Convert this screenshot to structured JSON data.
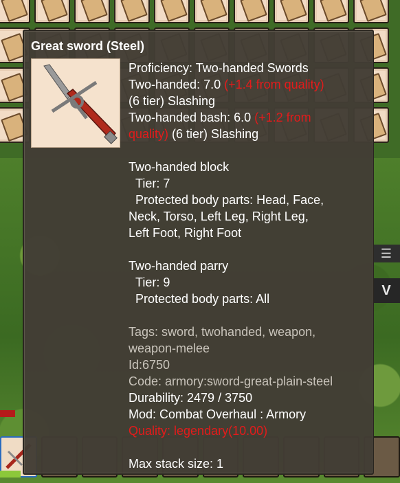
{
  "tooltip": {
    "title": "Great sword (Steel)",
    "icon": "great-sword-steel-icon",
    "proficiency": "Proficiency: Two-handed Swords",
    "two_handed": {
      "label": "Two-handed: 7.0 ",
      "quality_bonus": "(+1.4 from quality)",
      "tier": "(6 tier) Slashing"
    },
    "two_handed_bash": {
      "label": "Two-handed bash: 6.0 ",
      "quality_bonus_a": "(+1.2 from",
      "quality_bonus_b": "quality)",
      "tier": " (6 tier) Slashing"
    },
    "block": {
      "heading": "Two-handed block",
      "tier": "  Tier: 7",
      "parts_1": "  Protected body parts: Head, Face,",
      "parts_2": "Neck, Torso, Left Leg, Right Leg,",
      "parts_3": "Left Foot, Right Foot"
    },
    "parry": {
      "heading": "Two-handed parry",
      "tier": "  Tier: 9",
      "parts": "  Protected body parts: All"
    },
    "tags_1": "Tags: sword, twohanded, weapon,",
    "tags_2": "weapon-melee",
    "id": "Id:6750",
    "code": "Code: armory:sword-great-plain-steel",
    "durability": "Durability: 2479 / 3750",
    "mod": "Mod: Combat Overhaul : Armory",
    "quality": "Quality: legendary(10.00)",
    "max_stack": "Max stack size: 1"
  },
  "hud": {
    "right_button_label": "V",
    "menu_icon": "menu-icon"
  },
  "colors": {
    "tooltip_bg": "#423d35",
    "quality_red": "#e31b1b",
    "muted_text": "#c9c4bb"
  }
}
